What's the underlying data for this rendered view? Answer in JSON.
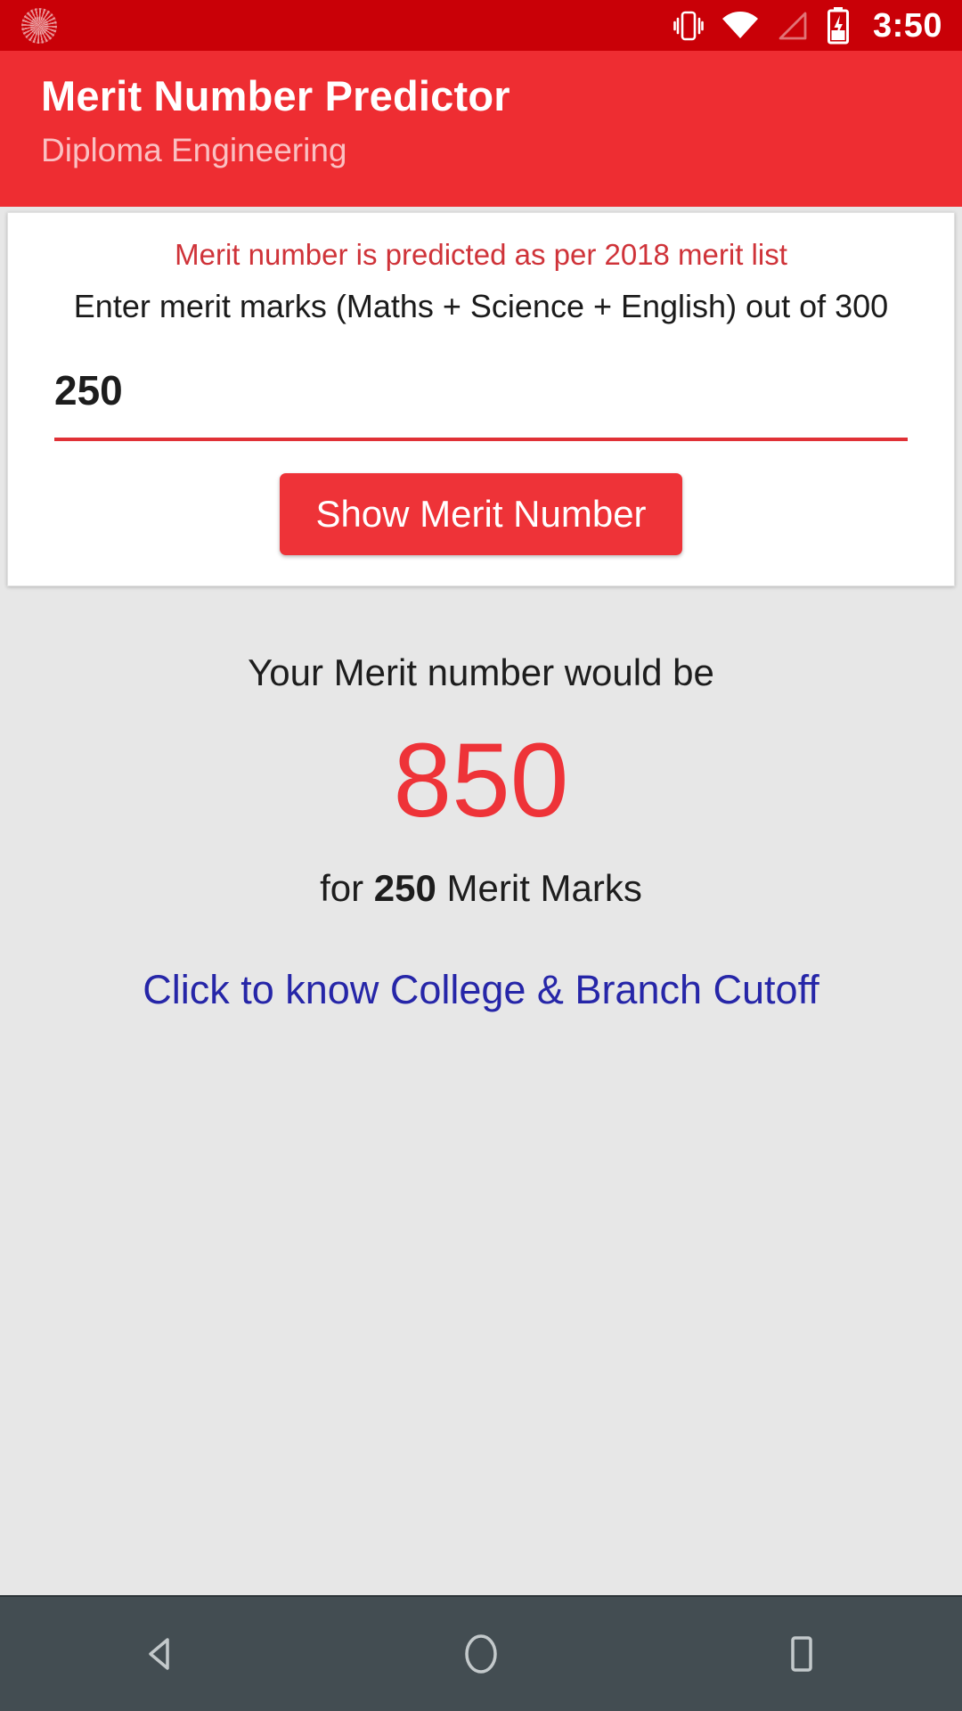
{
  "status_bar": {
    "notification_icon": "app-notification-icon",
    "icons": [
      "vibrate-icon",
      "wifi-icon",
      "cellular-signal-icon",
      "battery-charging-icon"
    ],
    "time": "3:50",
    "background_color": "#c90007"
  },
  "app_bar": {
    "title": "Merit Number Predictor",
    "subtitle": "Diploma Engineering",
    "background_color": "#ee2d32"
  },
  "card": {
    "note": "Merit number is predicted as per 2018 merit list",
    "note_color": "#cf3339",
    "field_label": "Enter merit marks (Maths + Science + English) out of 300",
    "input_value": "250",
    "input_placeholder": "Enter merit marks",
    "underline_color": "#e03136",
    "submit_label": "Show Merit Number",
    "submit_color": "#ee3338"
  },
  "result": {
    "caption": "Your Merit number would be",
    "merit_number": "850",
    "merit_number_color": "#ee3338",
    "sub_prefix": "for ",
    "sub_marks": "250",
    "sub_suffix": " Merit Marks",
    "link_label": "Click to know College & Branch Cutoff",
    "link_color": "#2626a8",
    "background_color": "#e7e7e7"
  },
  "nav_bar": {
    "background_color": "#434d52",
    "buttons": [
      {
        "name": "back-button",
        "icon": "back-triangle-icon"
      },
      {
        "name": "home-button",
        "icon": "home-circle-icon"
      },
      {
        "name": "recents-button",
        "icon": "recents-square-icon"
      }
    ]
  }
}
